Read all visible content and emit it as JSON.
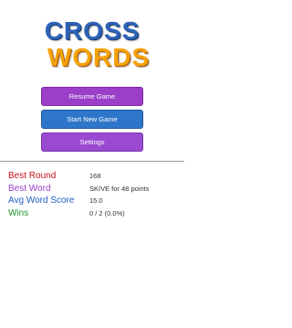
{
  "logo": {
    "line1": "CROSS",
    "line2": "WORDS"
  },
  "menu": {
    "resume_label": "Resume Game",
    "new_label": "Start New Game",
    "settings_label": "Settings"
  },
  "stats": [
    {
      "label": "Best Round",
      "value": "168",
      "color": "#c4101a"
    },
    {
      "label": "Best Word",
      "value": "SKIVE for 48 points",
      "color": "#9b41c9"
    },
    {
      "label": "Avg Word Score",
      "value": "15.0",
      "color": "#1f5fc0"
    },
    {
      "label": "Wins",
      "value": "0 / 2 (0.0%)",
      "color": "#1f9a2e"
    }
  ],
  "colors": {
    "logo_cross": "#2f63b8",
    "logo_words": "#f5a20a",
    "resume_button": "#9b3ec8",
    "new_game_button": "#2d76c9",
    "settings_button": "#9a4ad1"
  }
}
